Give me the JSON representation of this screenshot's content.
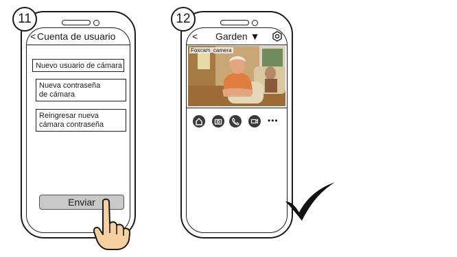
{
  "steps": [
    {
      "number": "11",
      "screen": {
        "header_back": "<",
        "header_title": "Cuenta de usuario",
        "fields": [
          "Nuevo usuario de cámara",
          "Nueva contraseña\nde cámara",
          "Reingresar nueva\ncámara contraseña"
        ],
        "submit_label": "Enviar"
      }
    },
    {
      "number": "12",
      "screen": {
        "header_back": "<",
        "header_title": "Garden ▼",
        "settings_icon": "settings-hexagon-icon",
        "feed_label": "Foscam_camera",
        "controls": [
          "home-icon",
          "snapshot-icon",
          "phone-icon",
          "record-icon"
        ],
        "more_label": "•••"
      }
    }
  ],
  "colors": {
    "outline": "#1a1a1a",
    "button_fill": "#c9c9c9",
    "hand_fill": "#f6cfa2",
    "icon_fill": "#3a3a3a"
  }
}
